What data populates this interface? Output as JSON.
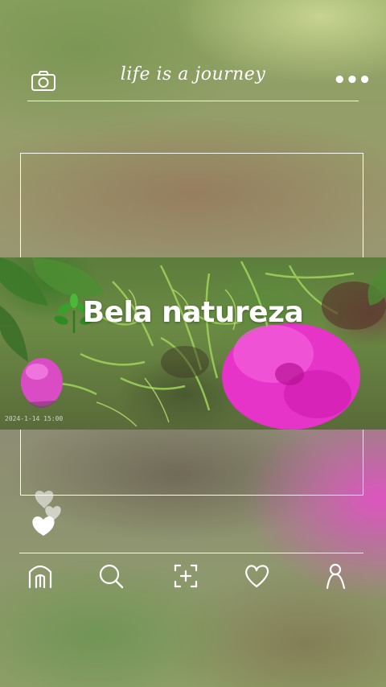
{
  "header": {
    "title": "life is a journey",
    "camera_icon": "camera-icon",
    "more_icon": "more-dots-icon",
    "more_glyph": "•••"
  },
  "post": {
    "caption": "Bela natureza",
    "caption_emoji_icon": "leaf-plant-icon",
    "stamp": "2024-1-14 15:00"
  },
  "reactions": {
    "icon": "heart-stack-icon"
  },
  "bottom_nav": [
    {
      "name": "home",
      "icon": "home-icon"
    },
    {
      "name": "search",
      "icon": "search-icon"
    },
    {
      "name": "add",
      "icon": "add-post-icon"
    },
    {
      "name": "likes",
      "icon": "heart-icon"
    },
    {
      "name": "profile",
      "icon": "profile-icon"
    }
  ],
  "colors": {
    "accent_white": "#ffffff",
    "flower_pink": "#e633c8"
  }
}
